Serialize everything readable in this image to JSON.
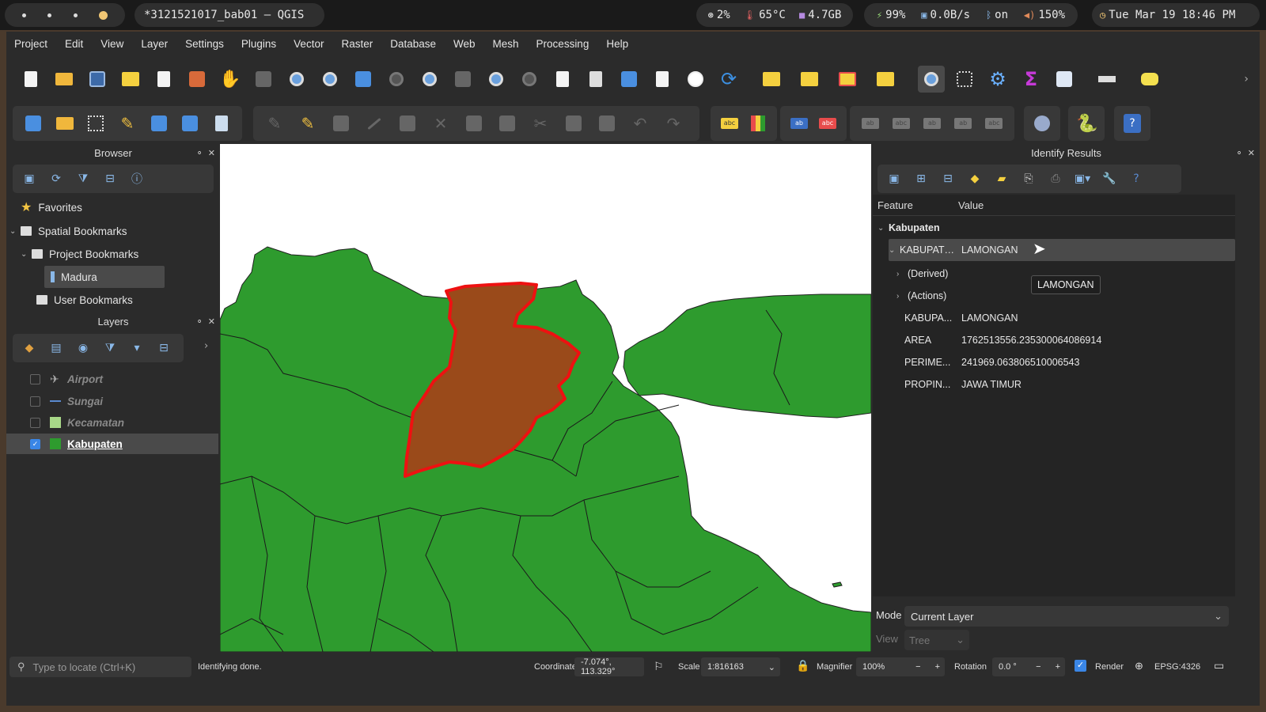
{
  "system_bar": {
    "window_title": "*3121521017_bab01 — QGIS",
    "cpu": "2%",
    "temp": "65°C",
    "memory": "4.7GB",
    "battery": "99%",
    "network": "0.0B/s",
    "bluetooth": "on",
    "volume": "150%",
    "clock": "Tue Mar 19 18:46 PM"
  },
  "menu": [
    "Project",
    "Edit",
    "View",
    "Layer",
    "Settings",
    "Plugins",
    "Vector",
    "Raster",
    "Database",
    "Web",
    "Mesh",
    "Processing",
    "Help"
  ],
  "browser": {
    "title": "Browser",
    "items": {
      "favorites": "Favorites",
      "spatial_bookmarks": "Spatial Bookmarks",
      "project_bookmarks": "Project Bookmarks",
      "madura": "Madura",
      "user_bookmarks": "User Bookmarks"
    }
  },
  "layers": {
    "title": "Layers",
    "items": [
      {
        "name": "Airport",
        "checked": false
      },
      {
        "name": "Sungai",
        "checked": false
      },
      {
        "name": "Kecamatan",
        "checked": false
      },
      {
        "name": "Kabupaten",
        "checked": true
      }
    ]
  },
  "identify": {
    "title": "Identify Results",
    "col_feature": "Feature",
    "col_value": "Value",
    "layer": "Kabupaten",
    "feature_row": {
      "field": "KABUPATE...",
      "value": "LAMONGAN"
    },
    "derived": "(Derived)",
    "actions": "(Actions)",
    "attributes": [
      {
        "field": "KABUPA...",
        "value": "LAMONGAN"
      },
      {
        "field": "AREA",
        "value": "1762513556.235300064086914"
      },
      {
        "field": "PERIME...",
        "value": "241969.063806510006543"
      },
      {
        "field": "PROPIN...",
        "value": "JAWA TIMUR"
      }
    ],
    "tooltip": "LAMONGAN",
    "mode_label": "Mode",
    "mode_value": "Current Layer",
    "view_label": "View",
    "view_value": "Tree"
  },
  "statusbar": {
    "locate_placeholder": "Type to locate (Ctrl+K)",
    "message": "Identifying done.",
    "coordinate_label": "Coordinate",
    "coordinate_value": "-7.074°, 113.329°",
    "scale_label": "Scale",
    "scale_value": "1:816163",
    "magnifier_label": "Magnifier",
    "magnifier_value": "100%",
    "rotation_label": "Rotation",
    "rotation_value": "0.0 °",
    "render_label": "Render",
    "crs": "EPSG:4326"
  },
  "colors": {
    "map_fill": "#2e9b2e",
    "selected_fill": "#9a4a1a",
    "selected_outline": "#ee1111",
    "accent": "#3a86e6"
  }
}
